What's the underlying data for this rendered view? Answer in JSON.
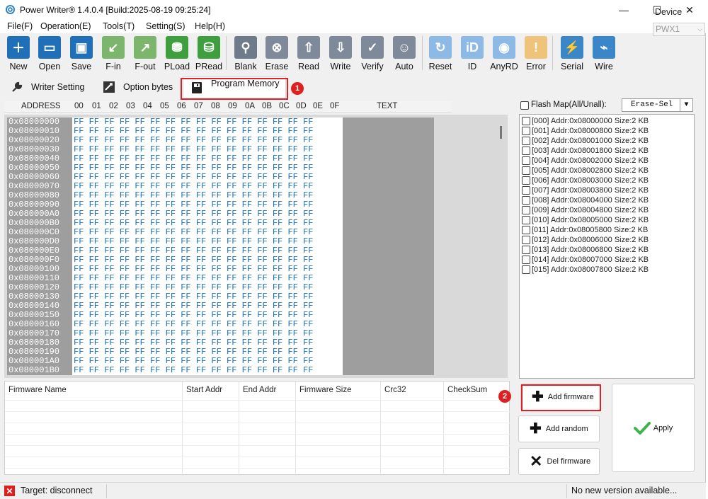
{
  "window": {
    "title": "Power Writer® 1.4.0.4 [Build:2025-08-19 09:25:24]",
    "controls": [
      "—",
      "☐",
      "✕"
    ]
  },
  "menu": [
    "File(F)",
    "Operation(E)",
    "Tools(T)",
    "Setting(S)",
    "Help(H)"
  ],
  "toolbar": [
    {
      "label": "New",
      "icon": "new-icon",
      "color": "#1f6fb9"
    },
    {
      "label": "Open",
      "icon": "open-folder-icon",
      "color": "#1f6fb9"
    },
    {
      "label": "Save",
      "icon": "save-icon",
      "color": "#1f6fb9"
    },
    {
      "label": "F-in",
      "icon": "file-in-icon",
      "color": "#7cb56c"
    },
    {
      "label": "F-out",
      "icon": "file-out-icon",
      "color": "#7cb56c"
    },
    {
      "label": "PLoad",
      "icon": "pload-icon",
      "color": "#3f9f3f"
    },
    {
      "label": "PRead",
      "icon": "pread-icon",
      "color": "#3f9f3f"
    },
    {
      "label": "Blank",
      "icon": "blank-check-icon",
      "color": "#6e7b8b"
    },
    {
      "label": "Erase",
      "icon": "erase-icon",
      "color": "#7e8a99"
    },
    {
      "label": "Read",
      "icon": "read-icon",
      "color": "#7e8a99"
    },
    {
      "label": "Write",
      "icon": "write-icon",
      "color": "#7e8a99"
    },
    {
      "label": "Verify",
      "icon": "verify-icon",
      "color": "#7e8a99"
    },
    {
      "label": "Auto",
      "icon": "robot-icon",
      "color": "#7e8a99"
    },
    {
      "label": "Reset",
      "icon": "reset-icon",
      "color": "#8db9e6"
    },
    {
      "label": "ID",
      "icon": "id-icon",
      "color": "#8db9e6"
    },
    {
      "label": "AnyRD",
      "icon": "anyrd-icon",
      "color": "#8db9e6"
    },
    {
      "label": "Error",
      "icon": "error-icon",
      "color": "#eec37a"
    },
    {
      "label": "Serial",
      "icon": "serial-icon",
      "color": "#3b86c8"
    },
    {
      "label": "Wire",
      "icon": "wire-icon",
      "color": "#3b86c8"
    }
  ],
  "device": {
    "label": "Device",
    "value": "PWX1"
  },
  "tabs": [
    {
      "label": "Writer Setting",
      "icon": "wrench-icon"
    },
    {
      "label": "Option bytes",
      "icon": "option-bytes-icon"
    },
    {
      "label": "Program Memory",
      "icon": "memory-chip-icon"
    }
  ],
  "annotations": [
    "1",
    "2"
  ],
  "hex": {
    "headers": [
      "ADDRESS",
      "00",
      "01",
      "02",
      "03",
      "04",
      "05",
      "06",
      "07",
      "08",
      "09",
      "0A",
      "0B",
      "0C",
      "0D",
      "0E",
      "0F",
      "TEXT"
    ],
    "addresses": [
      "0x08000000",
      "0x08000010",
      "0x08000020",
      "0x08000030",
      "0x08000040",
      "0x08000050",
      "0x08000060",
      "0x08000070",
      "0x08000080",
      "0x08000090",
      "0x080000A0",
      "0x080000B0",
      "0x080000C0",
      "0x080000D0",
      "0x080000E0",
      "0x080000F0",
      "0x08000100",
      "0x08000110",
      "0x08000120",
      "0x08000130",
      "0x08000140",
      "0x08000150",
      "0x08000160",
      "0x08000170",
      "0x08000180",
      "0x08000190",
      "0x080001A0",
      "0x080001B0"
    ],
    "byte_value": "FF"
  },
  "firmware_table": {
    "columns": [
      "Firmware Name",
      "Start Addr",
      "End Addr",
      "Firmware Size",
      "Crc32",
      "CheckSum"
    ]
  },
  "flash_map": {
    "label": "Flash Map(All/Unall):",
    "erase_mode": "Erase-Sel",
    "items": [
      "[000] Addr:0x08000000 Size:2 KB",
      "[001] Addr:0x08000800 Size:2 KB",
      "[002] Addr:0x08001000 Size:2 KB",
      "[003] Addr:0x08001800 Size:2 KB",
      "[004] Addr:0x08002000 Size:2 KB",
      "[005] Addr:0x08002800 Size:2 KB",
      "[006] Addr:0x08003000 Size:2 KB",
      "[007] Addr:0x08003800 Size:2 KB",
      "[008] Addr:0x08004000 Size:2 KB",
      "[009] Addr:0x08004800 Size:2 KB",
      "[010] Addr:0x08005000 Size:2 KB",
      "[011] Addr:0x08005800 Size:2 KB",
      "[012] Addr:0x08006000 Size:2 KB",
      "[013] Addr:0x08006800 Size:2 KB",
      "[014] Addr:0x08007000 Size:2 KB",
      "[015] Addr:0x08007800 Size:2 KB"
    ]
  },
  "buttons": {
    "add_firmware": "Add firmware",
    "add_random": "Add random",
    "del_firmware": "Del firmware",
    "apply": "Apply"
  },
  "status": {
    "target": "Target: disconnect",
    "version": "No new version available..."
  },
  "colors": {
    "accent_red": "#e02020",
    "hex_blue": "#1e70b5",
    "apply_green": "#3fb44a"
  }
}
